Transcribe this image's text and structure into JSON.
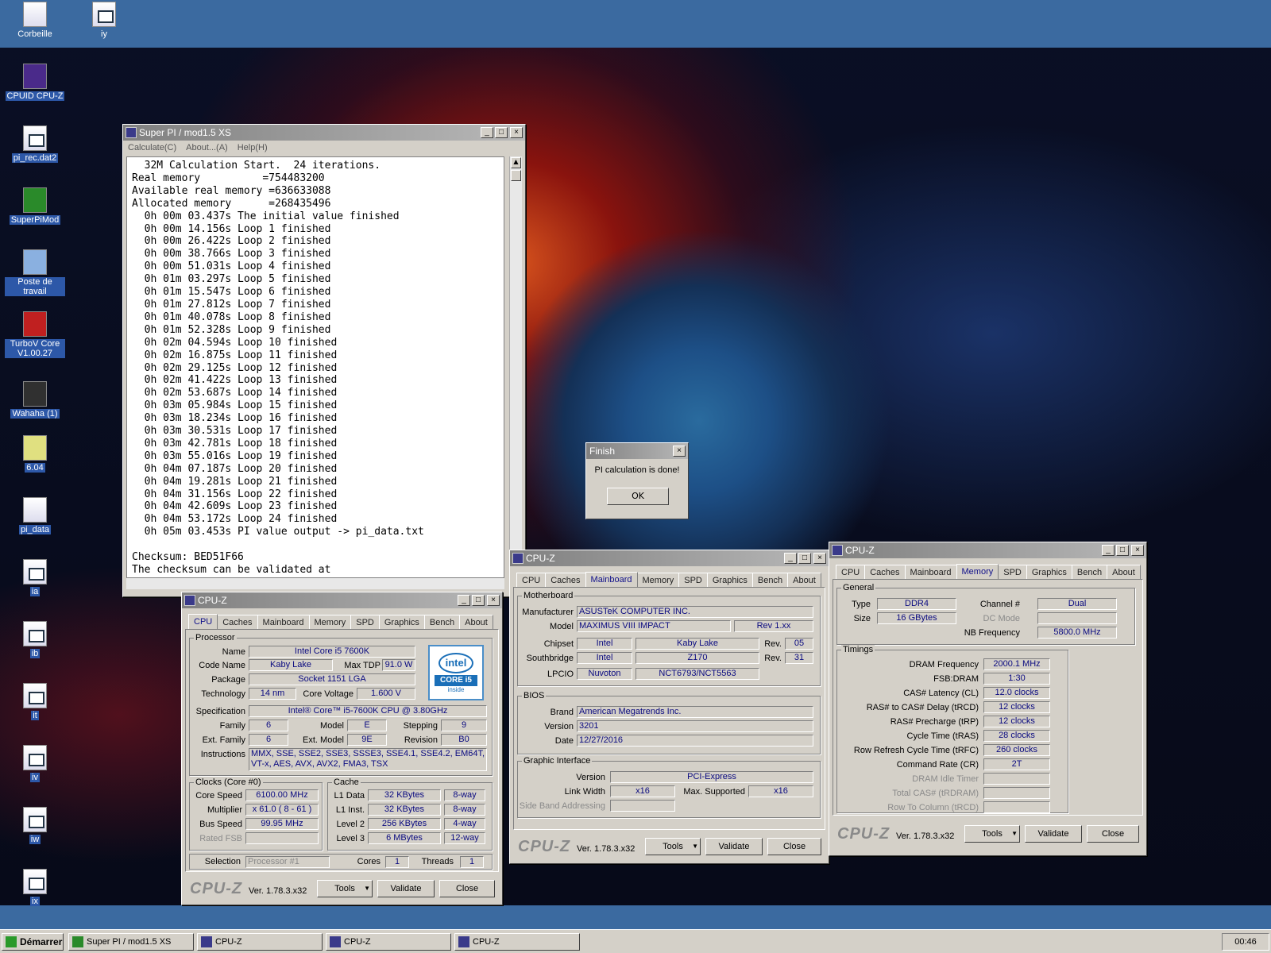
{
  "desktop": {
    "icons": [
      "Corbeille",
      "iy",
      "CPUID CPU-Z",
      "pi_rec.dat2",
      "SuperPiMod",
      "Poste de travail",
      "TurboV Core V1.00.27",
      "Wahaha (1)",
      "6.04",
      "pi_data",
      "ia",
      "ib",
      "it",
      "iv",
      "iw",
      "ix"
    ]
  },
  "superpi": {
    "title": "Super PI / mod1.5 XS",
    "menu": [
      "Calculate(C)",
      "About...(A)",
      "Help(H)"
    ],
    "console": "  32M Calculation Start.  24 iterations.\nReal memory          =754483200\nAvailable real memory =636633088\nAllocated memory      =268435496\n  0h 00m 03.437s The initial value finished\n  0h 00m 14.156s Loop 1 finished\n  0h 00m 26.422s Loop 2 finished\n  0h 00m 38.766s Loop 3 finished\n  0h 00m 51.031s Loop 4 finished\n  0h 01m 03.297s Loop 5 finished\n  0h 01m 15.547s Loop 6 finished\n  0h 01m 27.812s Loop 7 finished\n  0h 01m 40.078s Loop 8 finished\n  0h 01m 52.328s Loop 9 finished\n  0h 02m 04.594s Loop 10 finished\n  0h 02m 16.875s Loop 11 finished\n  0h 02m 29.125s Loop 12 finished\n  0h 02m 41.422s Loop 13 finished\n  0h 02m 53.687s Loop 14 finished\n  0h 03m 05.984s Loop 15 finished\n  0h 03m 18.234s Loop 16 finished\n  0h 03m 30.531s Loop 17 finished\n  0h 03m 42.781s Loop 18 finished\n  0h 03m 55.016s Loop 19 finished\n  0h 04m 07.187s Loop 20 finished\n  0h 04m 19.281s Loop 21 finished\n  0h 04m 31.156s Loop 22 finished\n  0h 04m 42.609s Loop 23 finished\n  0h 04m 53.172s Loop 24 finished\n  0h 05m 03.453s PI value output -> pi_data.txt\n\nChecksum: BED51F66\nThe checksum can be validated at"
  },
  "finish": {
    "title": "Finish",
    "message": "PI calculation is done!",
    "ok": "OK"
  },
  "cpuz_common": {
    "title": "CPU-Z",
    "tabs": [
      "CPU",
      "Caches",
      "Mainboard",
      "Memory",
      "SPD",
      "Graphics",
      "Bench",
      "About"
    ],
    "logo": "CPU-Z",
    "version": "Ver. 1.78.3.x32",
    "tools": "Tools",
    "validate": "Validate",
    "close": "Close"
  },
  "cpu": {
    "processor": "Processor",
    "name_l": "Name",
    "name": "Intel Core i5 7600K",
    "codename_l": "Code Name",
    "codename": "Kaby Lake",
    "maxtdp_l": "Max TDP",
    "maxtdp": "91.0 W",
    "package_l": "Package",
    "package": "Socket 1151 LGA",
    "tech_l": "Technology",
    "tech": "14 nm",
    "cv_l": "Core Voltage",
    "cv": "1.600 V",
    "spec_l": "Specification",
    "spec": "Intel® Core™ i5-7600K CPU @ 3.80GHz",
    "family_l": "Family",
    "family": "6",
    "model_l": "Model",
    "model": "E",
    "stepping_l": "Stepping",
    "stepping": "9",
    "extfam_l": "Ext. Family",
    "extfam": "6",
    "extmod_l": "Ext. Model",
    "extmod": "9E",
    "rev_l": "Revision",
    "rev": "B0",
    "instr_l": "Instructions",
    "instr": "MMX, SSE, SSE2, SSE3, SSSE3, SSE4.1, SSE4.2, EM64T, VT-x, AES, AVX, AVX2, FMA3, TSX",
    "clocks": "Clocks (Core #0)",
    "cs_l": "Core Speed",
    "cs": "6100.00 MHz",
    "mult_l": "Multiplier",
    "mult": "x 61.0 ( 8 - 61 )",
    "bus_l": "Bus Speed",
    "bus": "99.95 MHz",
    "rfsb_l": "Rated FSB",
    "rfsb": "",
    "cache": "Cache",
    "l1d_l": "L1 Data",
    "l1d": "32 KBytes",
    "l1d_w": "8-way",
    "l1i_l": "L1 Inst.",
    "l1i": "32 KBytes",
    "l1i_w": "8-way",
    "l2_l": "Level 2",
    "l2": "256 KBytes",
    "l2_w": "4-way",
    "l3_l": "Level 3",
    "l3": "6 MBytes",
    "l3_w": "12-way",
    "sel_l": "Selection",
    "sel": "Processor #1",
    "cores_l": "Cores",
    "cores": "1",
    "threads_l": "Threads",
    "threads": "1",
    "intel": {
      "brand": "intel",
      "line": "CORE i5",
      "inside": "inside"
    }
  },
  "mb": {
    "motherboard": "Motherboard",
    "man_l": "Manufacturer",
    "man": "ASUSTeK COMPUTER INC.",
    "model_l": "Model",
    "model": "MAXIMUS VIII IMPACT",
    "model_rev": "Rev 1.xx",
    "chipset_l": "Chipset",
    "chipset": "Intel",
    "chipset2": "Kaby Lake",
    "rev_l": "Rev.",
    "chipset_rev": "05",
    "south_l": "Southbridge",
    "south": "Intel",
    "south2": "Z170",
    "south_rev": "31",
    "lpcio_l": "LPCIO",
    "lpcio": "Nuvoton",
    "lpcio2": "NCT6793/NCT5563",
    "bios": "BIOS",
    "brand_l": "Brand",
    "brand": "American Megatrends Inc.",
    "ver_l": "Version",
    "ver": "3201",
    "date_l": "Date",
    "date": "12/27/2016",
    "gi": "Graphic Interface",
    "giver_l": "Version",
    "giver": "PCI-Express",
    "lw_l": "Link Width",
    "lw": "x16",
    "ms_l": "Max. Supported",
    "ms": "x16",
    "sba_l": "Side Band Addressing"
  },
  "mem": {
    "general": "General",
    "type_l": "Type",
    "type": "DDR4",
    "ch_l": "Channel #",
    "ch": "Dual",
    "size_l": "Size",
    "size": "16 GBytes",
    "dc_l": "DC Mode",
    "nb_l": "NB Frequency",
    "nb": "5800.0 MHz",
    "timings": "Timings",
    "rows": [
      [
        "DRAM Frequency",
        "2000.1 MHz"
      ],
      [
        "FSB:DRAM",
        "1:30"
      ],
      [
        "CAS# Latency (CL)",
        "12.0 clocks"
      ],
      [
        "RAS# to CAS# Delay (tRCD)",
        "12 clocks"
      ],
      [
        "RAS# Precharge (tRP)",
        "12 clocks"
      ],
      [
        "Cycle Time (tRAS)",
        "28 clocks"
      ],
      [
        "Row Refresh Cycle Time (tRFC)",
        "260 clocks"
      ],
      [
        "Command Rate (CR)",
        "2T"
      ],
      [
        "DRAM Idle Timer",
        ""
      ],
      [
        "Total CAS# (tRDRAM)",
        ""
      ],
      [
        "Row To Column (tRCD)",
        ""
      ]
    ]
  },
  "taskbar": {
    "start": "Démarrer",
    "items": [
      "Super PI / mod1.5 XS",
      "CPU-Z",
      "CPU-Z",
      "CPU-Z"
    ],
    "clock": "00:46"
  }
}
